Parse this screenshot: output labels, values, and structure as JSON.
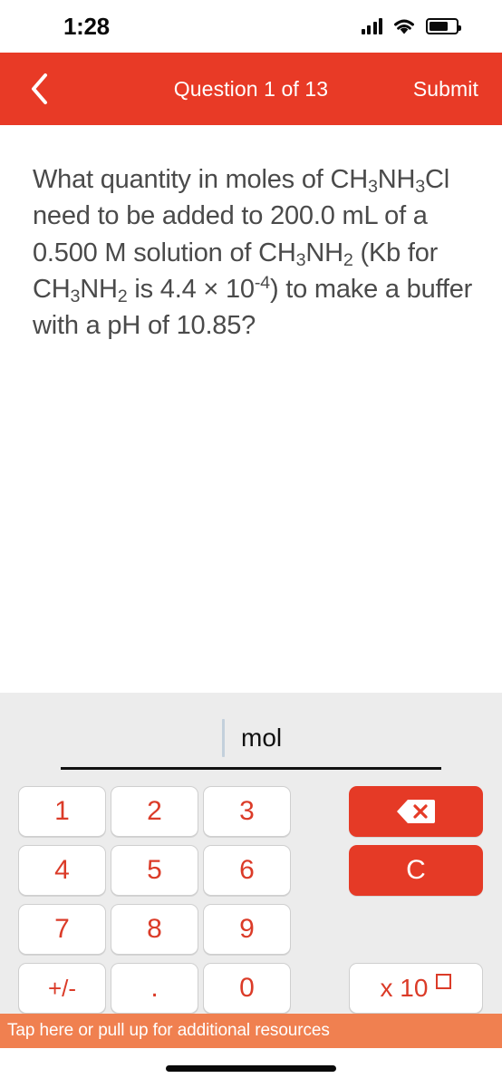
{
  "status_bar": {
    "time": "1:28",
    "signal_icon": "cellular-signal-icon",
    "wifi_icon": "wifi-icon",
    "battery_icon": "battery-icon",
    "battery_level_percent": 72
  },
  "nav_bar": {
    "back_icon": "chevron-left-icon",
    "title": "Question 1 of 13",
    "submit_label": "Submit",
    "background_color": "#E83A26"
  },
  "question": {
    "line1": "What quantity in moles of",
    "formula_prefix": "CH",
    "full_text": "What quantity in moles of CH3NH3Cl need to be added to 200.0 mL of a 0.500 M solution of CH3NH2 (Kb for CH3NH2 is 4.4 × 10-4) to make a buffer with a pH of 10.85?",
    "parts": {
      "p1": "What quantity in moles of ",
      "p2": "CH",
      "sub1": "3",
      "p3": "NH",
      "sub2": "3",
      "p4": "Cl",
      "p5": "  need to be added to 200.0 mL of a 0.500 M solution of ",
      "p6": "CH",
      "sub3": "3",
      "p7": "NH",
      "sub4": "2",
      "p8": " (Kb for ",
      "p9": "CH",
      "sub5": "3",
      "p10": "NH",
      "sub6": "2",
      "p11": " is 4.4 × 10",
      "sup1": "-4",
      "p12": ") to make a buffer with a pH of 10.85?"
    },
    "text_color": "#4a4a4a"
  },
  "answer_input": {
    "value": "",
    "unit": "mol",
    "caret_visible": true
  },
  "keypad": {
    "keys": [
      {
        "label": "1",
        "name": "key-1"
      },
      {
        "label": "2",
        "name": "key-2"
      },
      {
        "label": "3",
        "name": "key-3"
      },
      {
        "label": "4",
        "name": "key-4"
      },
      {
        "label": "5",
        "name": "key-5"
      },
      {
        "label": "6",
        "name": "key-6"
      },
      {
        "label": "7",
        "name": "key-7"
      },
      {
        "label": "8",
        "name": "key-8"
      },
      {
        "label": "9",
        "name": "key-9"
      },
      {
        "label": "+/-",
        "name": "key-plus-minus"
      },
      {
        "label": ".",
        "name": "key-decimal"
      },
      {
        "label": "0",
        "name": "key-0"
      }
    ],
    "backspace_icon": "backspace-delete-icon",
    "clear_label": "C",
    "scientific_label": "x 10",
    "key_text_color": "#DB3B28",
    "action_button_color": "#E53A26",
    "panel_background": "#ECECEC"
  },
  "resources_bar": {
    "label": "Tap here or pull up for additional resources",
    "background_color": "#F08050"
  },
  "home_indicator": {
    "name": "home-indicator"
  }
}
